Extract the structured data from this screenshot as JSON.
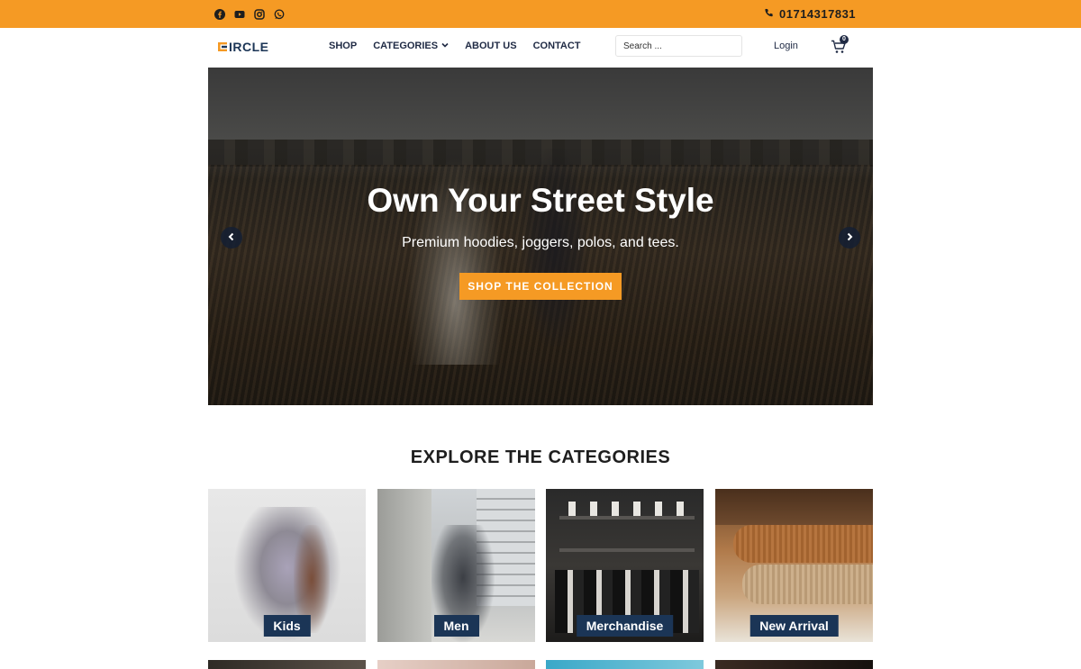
{
  "topbar": {
    "social_icons": [
      "facebook-icon",
      "youtube-icon",
      "instagram-icon",
      "whatsapp-icon"
    ],
    "phone": "01714317831",
    "accent_color": "#f59a24"
  },
  "header": {
    "logo_text": "CIRCLE",
    "nav": [
      {
        "label": "SHOP"
      },
      {
        "label": "CATEGORIES",
        "has_dropdown": true
      },
      {
        "label": "ABOUT US"
      },
      {
        "label": "CONTACT"
      }
    ],
    "search_placeholder": "Search ...",
    "login_label": "Login",
    "cart_count": "0"
  },
  "hero": {
    "title": "Own Your Street Style",
    "subtitle": "Premium hoodies, joggers, polos, and tees.",
    "button_label": "SHOP THE COLLECTION"
  },
  "categories": {
    "heading": "EXPLORE THE CATEGORIES",
    "items": [
      {
        "label": "Kids"
      },
      {
        "label": "Men"
      },
      {
        "label": "Merchandise"
      },
      {
        "label": "New Arrival"
      }
    ],
    "label_color": "#1b3556"
  }
}
